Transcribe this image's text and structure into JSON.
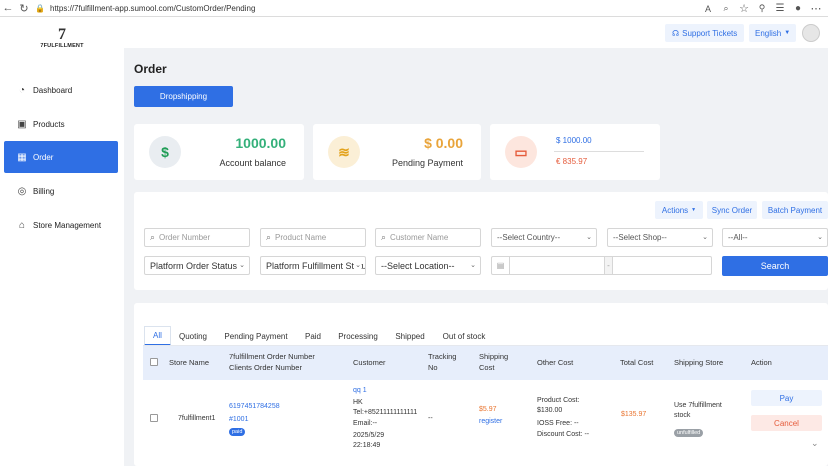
{
  "browser": {
    "url": "https://7fulfillment-app.sumool.com/CustomOrder/Pending"
  },
  "logo": {
    "mark": "7",
    "text": "7FULFILLMENT"
  },
  "sidebar": {
    "items": [
      {
        "label": "Dashboard",
        "icon": "dashboard-icon"
      },
      {
        "label": "Products",
        "icon": "box-icon"
      },
      {
        "label": "Order",
        "icon": "grid-icon",
        "active": true
      },
      {
        "label": "Billing",
        "icon": "coins-icon"
      },
      {
        "label": "Store Management",
        "icon": "store-icon"
      }
    ]
  },
  "header": {
    "support_label": "Support Tickets",
    "language": "English"
  },
  "page": {
    "title": "Order",
    "dropshipping_label": "Dropshipping"
  },
  "cards": {
    "balance_value": "1000.00",
    "balance_label": "Account balance",
    "pending_value": "$ 0.00",
    "pending_label": "Pending Payment",
    "usd_value": "$ 1000.00",
    "eur_value": "€ 835.97"
  },
  "filters": {
    "actions_label": "Actions",
    "sync_label": "Sync Order",
    "batch_label": "Batch Payment",
    "order_number_placeholder": "Order Number",
    "product_name_placeholder": "Product Name",
    "customer_name_placeholder": "Customer Name",
    "country_value": "--Select Country--",
    "shop_value": "--Select Shop--",
    "all_value": "--All--",
    "platform_status_value": "Platform Order Status",
    "platform_fulfillment_value": "Platform Fulfillment Status",
    "location_value": "--Select Location--",
    "date_separator": "-",
    "search_label": "Search"
  },
  "tabs": [
    "All",
    "Quoting",
    "Pending Payment",
    "Paid",
    "Processing",
    "Shipped",
    "Out of stock"
  ],
  "table": {
    "headers": {
      "store_name": "Store Name",
      "order_number": "7fulfillment Order Number",
      "client_order": "Clients Order Number",
      "customer": "Customer",
      "tracking_1": "Tracking",
      "tracking_2": "No",
      "shipping_1": "Shipping",
      "shipping_2": "Cost",
      "other_cost": "Other Cost",
      "total_cost": "Total Cost",
      "shipping_store": "Shipping Store",
      "action": "Action"
    },
    "row": {
      "store": "7fulfillment1",
      "order_number": "6197451784258",
      "client_order": "#1001",
      "status_badge": "paid",
      "customer_name": "qq 1",
      "customer_country": "HK",
      "customer_tel": "Tel:+85211111111111",
      "customer_email": "Email:--",
      "customer_date": "2025/5/29",
      "customer_time": "22:18:49",
      "tracking": "--",
      "shipping_cost": "$5.97",
      "shipping_register": "register",
      "product_cost_label": "Product Cost:",
      "product_cost_value": "$130.00",
      "ioss_fee": "IOSS Free:  --",
      "discount_cost": "Discount Cost:  --",
      "total_cost": "$135.97",
      "shipping_store_1": "Use 7fulfillment",
      "shipping_store_2": "stock",
      "fulfill_badge": "unfulfilled",
      "pay_label": "Pay",
      "cancel_label": "Cancel"
    }
  }
}
